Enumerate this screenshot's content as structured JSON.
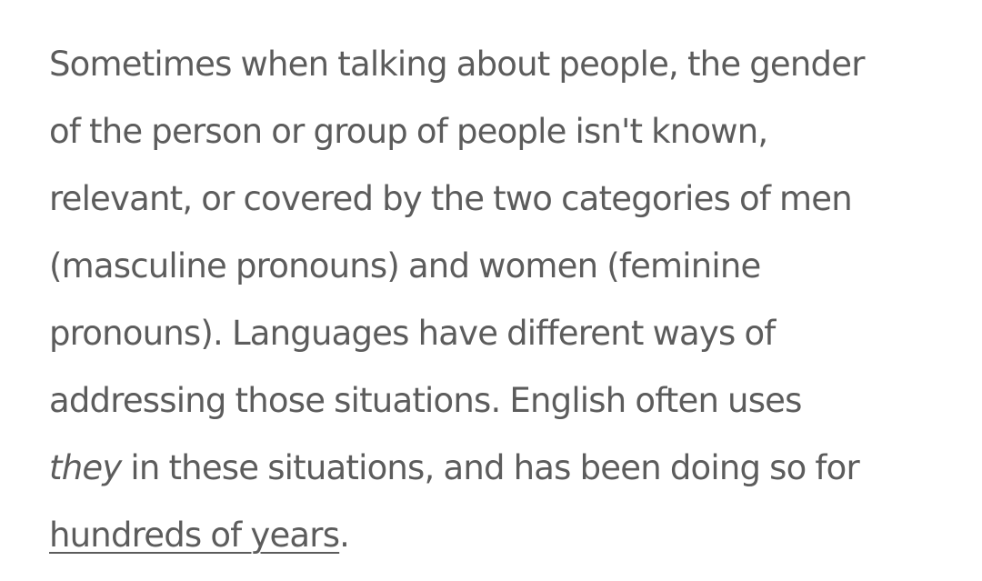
{
  "paragraph": {
    "line1": "Sometimes when talking about people, the gender",
    "line2": "of the person or group of people isn't known,",
    "line3": "relevant, or covered by the two categories of men",
    "line4": "(masculine pronouns) and women (feminine",
    "line5": "pronouns). Languages have different ways of",
    "line6": "addressing those situations. English often uses",
    "line7_emphasis": "they",
    "line7_rest": " in these situations, and has been doing so for",
    "link_text": "hundreds of years",
    "end_punct": "."
  },
  "colors": {
    "text": "#5c5c5c",
    "background": "#ffffff"
  }
}
